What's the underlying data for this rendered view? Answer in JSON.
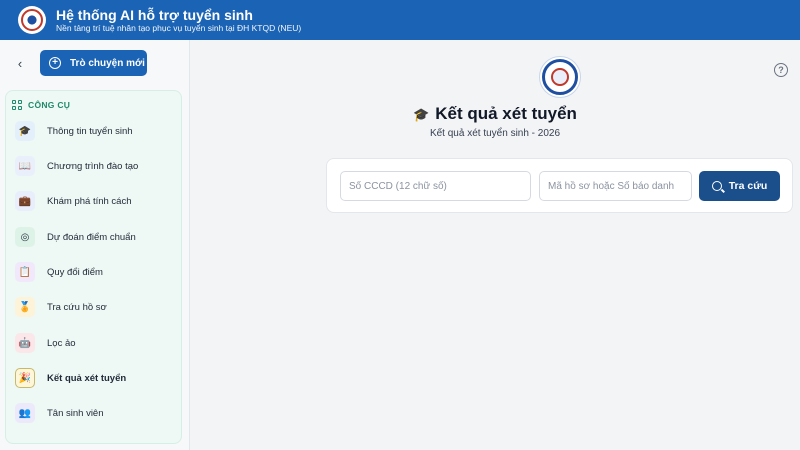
{
  "header": {
    "title": "Hệ thống AI hỗ trợ tuyển sinh",
    "subtitle": "Nền tảng trí tuệ nhân tạo phục vụ tuyển sinh tại ĐH KTQD (NEU)"
  },
  "sidebar": {
    "back_icon": "‹",
    "new_chat_label": "Trò chuyện mới",
    "tools_label": "CÔNG CỤ",
    "items": [
      {
        "label": "Thông tin tuyển sinh",
        "icon": "graduation-cap-icon",
        "glyph": "🎓",
        "color": "#e3f0fb"
      },
      {
        "label": "Chương trình đào tạo",
        "icon": "book-icon",
        "glyph": "📖",
        "color": "#eaf0fb"
      },
      {
        "label": "Khám phá tính cách",
        "icon": "briefcase-icon",
        "glyph": "💼",
        "color": "#e8eefb"
      },
      {
        "label": "Dự đoán điểm chuẩn",
        "icon": "target-icon",
        "glyph": "◎",
        "color": "#ddf3e8"
      },
      {
        "label": "Quy đổi điểm",
        "icon": "clipboard-icon",
        "glyph": "📋",
        "color": "#f1e8fb"
      },
      {
        "label": "Tra cứu hồ sơ",
        "icon": "award-icon",
        "glyph": "🏅",
        "color": "#fdf3d8"
      },
      {
        "label": "Lọc ảo",
        "icon": "robot-icon",
        "glyph": "🤖",
        "color": "#fbe7ea"
      },
      {
        "label": "Kết quả xét tuyển",
        "icon": "party-popper-icon",
        "glyph": "🎉",
        "color": "#fdf6d8"
      },
      {
        "label": "Tân sinh viên",
        "icon": "users-icon",
        "glyph": "👥",
        "color": "#ece9fb"
      }
    ],
    "active_index": 7
  },
  "main": {
    "help_icon": "?",
    "title": "Kết quả xét tuyển",
    "title_icon": "🎓",
    "subtitle": "Kết quả xét tuyển sinh - 2026",
    "search": {
      "cccd_placeholder": "Số CCCD (12 chữ số)",
      "cccd_value": "",
      "profile_placeholder": "Mã hồ sơ hoặc Số báo danh",
      "profile_value": "",
      "button_label": "Tra cứu"
    }
  },
  "colors": {
    "header_bg": "#1b63b5",
    "primary_button": "#1b4f8c",
    "tools_accent": "#1f8a6a"
  }
}
